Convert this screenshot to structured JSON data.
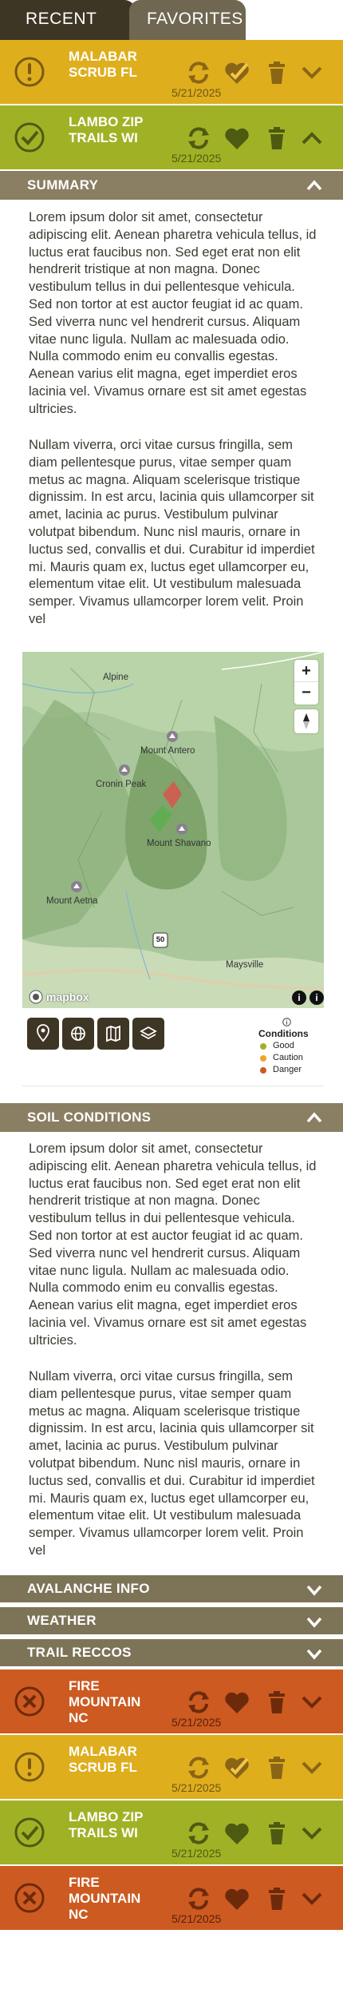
{
  "tabs": {
    "recent": "RECENT",
    "favorites": "FAVORITES"
  },
  "cards": [
    {
      "name": "MALABAR SCRUB FL",
      "date": "5/21/2025",
      "status": "caution",
      "color": "#dfae1d"
    },
    {
      "name": "LAMBO ZIP TRAILS WI",
      "date": "5/21/2025",
      "status": "good",
      "color": "#a1b125"
    },
    {
      "name": "FIRE MOUNTAIN NC",
      "date": "5/21/2025",
      "status": "danger",
      "color": "#cc5a21"
    },
    {
      "name": "MALABAR SCRUB FL",
      "date": "5/21/2025",
      "status": "caution",
      "color": "#dfae1d"
    },
    {
      "name": "LAMBO ZIP TRAILS WI",
      "date": "5/21/2025",
      "status": "good",
      "color": "#a1b125"
    },
    {
      "name": "FIRE MOUNTAIN NC",
      "date": "5/21/2025",
      "status": "danger",
      "color": "#cc5a21"
    }
  ],
  "sections": {
    "summary": "SUMMARY",
    "soil": "SOIL CONDITIONS",
    "avalanche": "AVALANCHE INFO",
    "weather": "WEATHER",
    "trail": "TRAIL RECCOS"
  },
  "summary_text": {
    "p1": "Lorem ipsum dolor sit amet, consectetur adipiscing elit. Aenean pharetra vehicula tellus, id luctus erat faucibus non. Sed eget erat non elit hendrerit tristique at non magna. Donec vestibulum tellus in dui pellentesque vehicula. Sed non tortor at est auctor feugiat id ac quam. Sed viverra nunc vel hendrerit cursus. Aliquam vitae nunc ligula. Nullam ac malesuada odio. Nulla commodo enim eu convallis egestas. Aenean varius elit magna, eget imperdiet eros lacinia vel. Vivamus ornare est sit amet egestas ultricies.",
    "p2": "Nullam viverra, orci vitae cursus fringilla, sem diam pellentesque purus, vitae semper quam metus ac magna. Aliquam scelerisque tristique dignissim. In est arcu, lacinia quis ullamcorper sit amet, lacinia ac purus. Vestibulum pulvinar volutpat bibendum. Nunc nisl mauris, ornare in luctus sed, convallis et dui. Curabitur id imperdiet mi. Mauris quam ex, luctus eget ullamcorper eu, elementum vitae elit. Ut vestibulum malesuada semper. Vivamus ullamcorper lorem velit. Proin vel"
  },
  "soil_text": {
    "p1": "Lorem ipsum dolor sit amet, consectetur adipiscing elit. Aenean pharetra vehicula tellus, id luctus erat faucibus non. Sed eget erat non elit hendrerit tristique at non magna. Donec vestibulum tellus in dui pellentesque vehicula. Sed non tortor at est auctor feugiat id ac quam. Sed viverra nunc vel hendrerit cursus. Aliquam vitae nunc ligula. Nullam ac malesuada odio. Nulla commodo enim eu convallis egestas. Aenean varius elit magna, eget imperdiet eros lacinia vel. Vivamus ornare est sit amet egestas ultricies.",
    "p2": "Nullam viverra, orci vitae cursus fringilla, sem diam pellentesque purus, vitae semper quam metus ac magna. Aliquam scelerisque tristique dignissim. In est arcu, lacinia quis ullamcorper sit amet, lacinia ac purus. Vestibulum pulvinar volutpat bibendum. Nunc nisl mauris, ornare in luctus sed, convallis et dui. Curabitur id imperdiet mi. Mauris quam ex, luctus eget ullamcorper eu, elementum vitae elit. Ut vestibulum malesuada semper. Vivamus ullamcorper lorem velit. Proin vel"
  },
  "map": {
    "labels": {
      "alpine": "Alpine",
      "antero": "Mount Antero",
      "cronin": "Cronin Peak",
      "shavano": "Mount Shavano",
      "aetna": "Mount Aetna",
      "maysville": "Maysville",
      "route": "50"
    },
    "logo": "mapbox",
    "zoom_in": "+",
    "zoom_out": "−",
    "info": "i",
    "legend": {
      "title": "Conditions",
      "items": [
        {
          "label": "Good",
          "color": "#a1b125"
        },
        {
          "label": "Caution",
          "color": "#f0a22a"
        },
        {
          "label": "Danger",
          "color": "#cc5a21"
        }
      ]
    }
  },
  "icons": {
    "status": [
      "caution-icon",
      "check-icon",
      "x-icon"
    ],
    "actions": [
      "refresh-icon",
      "heart-icon",
      "trash-icon",
      "chevron-icon"
    ]
  }
}
